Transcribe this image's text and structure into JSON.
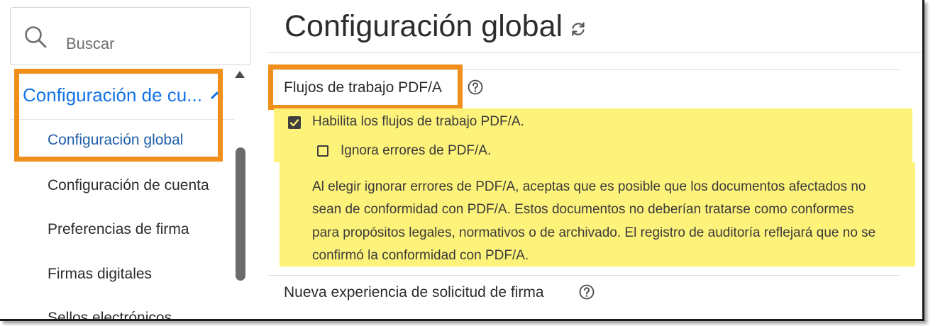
{
  "search": {
    "placeholder": "Buscar",
    "icon": "search-icon"
  },
  "sidebar": {
    "group_label": "Configuración de cu...",
    "group_icon": "chevron-up-icon",
    "items": [
      {
        "label": "Configuración global",
        "active": true
      },
      {
        "label": "Configuración de cuenta",
        "active": false
      },
      {
        "label": "Preferencias de firma",
        "active": false
      },
      {
        "label": "Firmas digitales",
        "active": false
      },
      {
        "label": "Sellos electrónicos",
        "active": false
      }
    ]
  },
  "main": {
    "title": "Configuración global",
    "title_icon": "refresh-icon",
    "sections": [
      {
        "heading": "Flujos de trabajo PDF/A",
        "help_icon": "help-icon",
        "options": [
          {
            "label": "Habilita los flujos de trabajo PDF/A.",
            "checked": true
          },
          {
            "label": "Ignora errores de PDF/A.",
            "checked": false
          }
        ],
        "description_lines": [
          "Al elegir ignorar errores de PDF/A, aceptas que es posible que los documentos afectados no",
          "sean de conformidad con PDF/A. Estos documentos no deberían tratarse como conformes",
          "para propósitos legales, normativos o de archivado. El registro de auditoría reflejará que no se",
          "confirmó la conformidad con PDF/A."
        ]
      },
      {
        "heading": "Nueva experiencia de solicitud de firma",
        "help_icon": "help-icon"
      }
    ]
  },
  "colors": {
    "accent_blue": "#1473e6",
    "active_nav": "#1f5fa8",
    "highlight_orange": "#f08f1c",
    "highlight_yellow": "#fdf27a",
    "scrollbar": "#6b6b6b"
  }
}
